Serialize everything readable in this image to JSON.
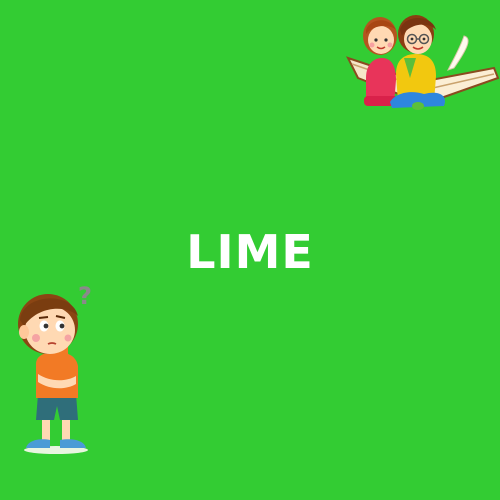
{
  "card": {
    "background_color": "#33cc33",
    "word": "LIME",
    "text_color": "#ffffff"
  },
  "illustrations": [
    {
      "name": "children-reading-book-illustration"
    },
    {
      "name": "thinking-boy-illustration"
    }
  ]
}
